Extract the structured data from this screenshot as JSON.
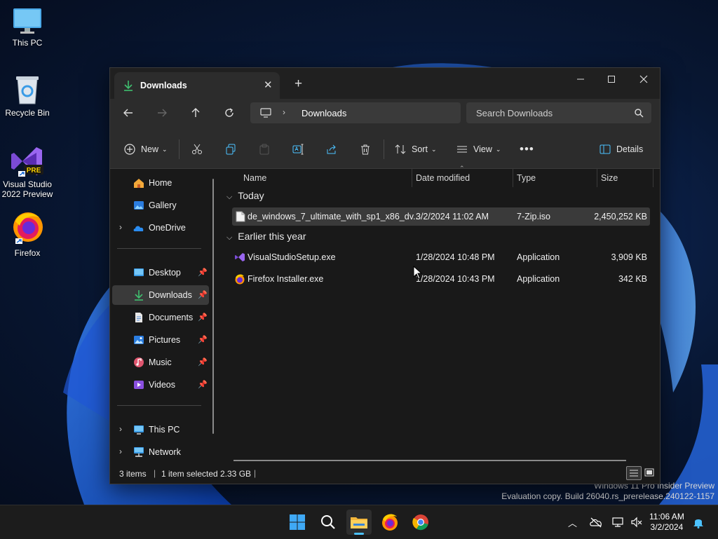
{
  "desktop": {
    "icons": [
      {
        "label": "This PC"
      },
      {
        "label": "Recycle Bin"
      },
      {
        "label": "Visual Studio 2022 Preview",
        "badge": "PRE"
      },
      {
        "label": "Firefox"
      }
    ],
    "watermark": {
      "line1": "Windows 11 Pro Insider Preview",
      "line2": "Evaluation copy. Build 26040.rs_prerelease.240122-1157"
    }
  },
  "window": {
    "tab_title": "Downloads",
    "address": {
      "crumb": "Downloads"
    },
    "search": {
      "placeholder": "Search Downloads"
    },
    "toolbar": {
      "new_label": "New",
      "sort_label": "Sort",
      "view_label": "View",
      "details_label": "Details"
    },
    "sidebar": {
      "items": [
        {
          "label": "Home",
          "icon": "home-icon"
        },
        {
          "label": "Gallery",
          "icon": "gallery-icon"
        },
        {
          "label": "OneDrive",
          "icon": "onedrive-icon"
        },
        {
          "label": "Desktop",
          "icon": "desktop-icon"
        },
        {
          "label": "Downloads",
          "icon": "downloads-icon"
        },
        {
          "label": "Documents",
          "icon": "documents-icon"
        },
        {
          "label": "Pictures",
          "icon": "pictures-icon"
        },
        {
          "label": "Music",
          "icon": "music-icon"
        },
        {
          "label": "Videos",
          "icon": "videos-icon"
        },
        {
          "label": "This PC",
          "icon": "this-pc-icon"
        },
        {
          "label": "Network",
          "icon": "network-icon"
        }
      ]
    },
    "columns": {
      "name": "Name",
      "date": "Date modified",
      "type": "Type",
      "size": "Size"
    },
    "groups": [
      {
        "label": "Today",
        "files": [
          {
            "name": "de_windows_7_ultimate_with_sp1_x86_dv...",
            "date": "3/2/2024 11:02 AM",
            "type": "7-Zip.iso",
            "size": "2,450,252 KB",
            "selected": true
          }
        ]
      },
      {
        "label": "Earlier this year",
        "files": [
          {
            "name": "VisualStudioSetup.exe",
            "date": "1/28/2024 10:48 PM",
            "type": "Application",
            "size": "3,909 KB"
          },
          {
            "name": "Firefox Installer.exe",
            "date": "1/28/2024 10:43 PM",
            "type": "Application",
            "size": "342 KB"
          }
        ]
      }
    ],
    "status": {
      "items": "3 items",
      "selected": "1 item selected",
      "size": "2.33 GB"
    }
  },
  "taskbar": {
    "clock": {
      "time": "11:06 AM",
      "date": "3/2/2024"
    }
  },
  "colors": {
    "accent": "#4cc2ff",
    "download_green": "#3fbf6f",
    "selection": "#3a3a3a"
  }
}
